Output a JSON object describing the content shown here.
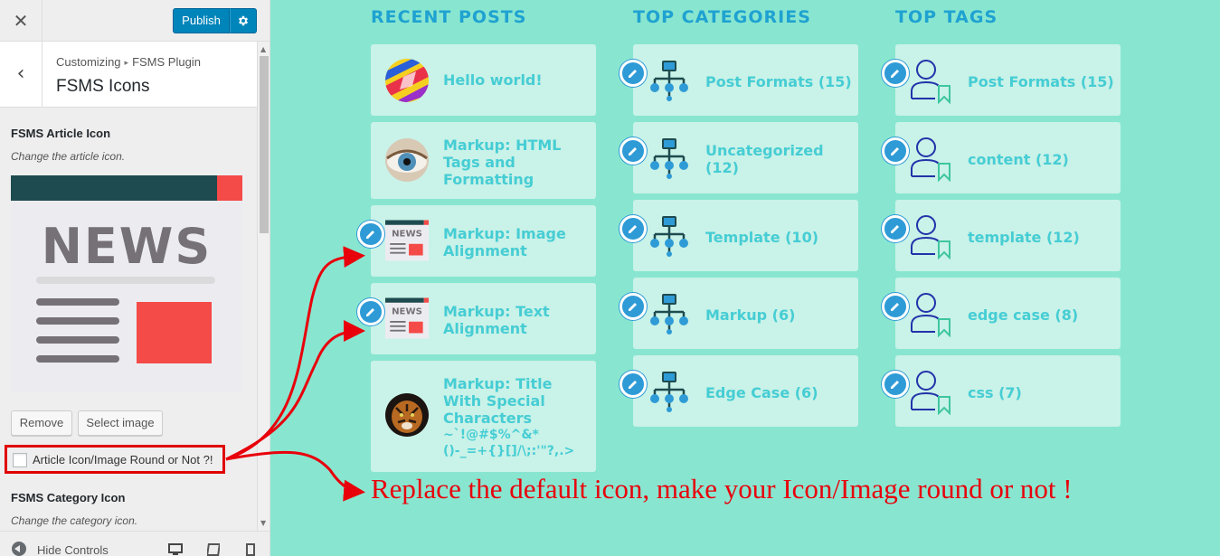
{
  "customizer": {
    "close_label": "✕",
    "publish_label": "Publish",
    "breadcrumb": {
      "parent": "Customizing",
      "separator": "▸",
      "child": "FSMS Plugin"
    },
    "section_title": "FSMS Icons",
    "article_icon": {
      "title": "FSMS Article Icon",
      "description": "Change the article icon.",
      "news_word": "NEWS"
    },
    "remove_label": "Remove",
    "select_image_label": "Select image",
    "round_checkbox_label": "Article Icon/Image Round or Not ?!",
    "round_checked": false,
    "category_icon": {
      "title": "FSMS Category Icon",
      "description": "Change the category icon."
    },
    "footer": {
      "hide_controls": "Hide Controls"
    }
  },
  "preview": {
    "columns": [
      {
        "title": "RECENT POSTS",
        "items": [
          {
            "text": [
              "Hello world!"
            ],
            "thumb": "colorful-art-thumb"
          },
          {
            "text": [
              "Markup: HTML",
              "Tags and",
              "Formatting"
            ],
            "thumb": "eye-thumb"
          },
          {
            "text": [
              "Markup: Image",
              "Alignment"
            ],
            "thumb": "news-icon"
          },
          {
            "text": [
              "Markup: Text",
              "Alignment"
            ],
            "thumb": "news-icon"
          },
          {
            "text": [
              "Markup: Title",
              "With Special",
              "Characters"
            ],
            "extra": [
              "~`!@#$%^&*",
              "()-_=+{}[]/\\;:'\"?,.>"
            ],
            "thumb": "tiger-thumb"
          }
        ]
      },
      {
        "title": "TOP CATEGORIES",
        "items": [
          {
            "text": [
              "Post Formats (15)"
            ]
          },
          {
            "text": [
              "Uncategorized",
              "(12)"
            ]
          },
          {
            "text": [
              "Template (10)"
            ]
          },
          {
            "text": [
              "Markup (6)"
            ]
          },
          {
            "text": [
              "Edge Case (6)"
            ]
          }
        ]
      },
      {
        "title": "TOP TAGS",
        "items": [
          {
            "text": [
              "Post Formats (15)"
            ]
          },
          {
            "text": [
              "content (12)"
            ]
          },
          {
            "text": [
              "template (12)"
            ]
          },
          {
            "text": [
              "edge case (8)"
            ]
          },
          {
            "text": [
              "css (7)"
            ]
          }
        ]
      }
    ],
    "annotation": "Replace the default icon, make your Icon/Image round or not !"
  },
  "colors": {
    "preview_bg": "#88e6d0",
    "card_bg": "#c9f2e8",
    "column_title": "#1fa2d1",
    "item_text": "#46cdd4",
    "pencil_badge": "#2e9bd6",
    "annotation": "#e8000b",
    "publish_button": "#0085ba"
  },
  "icons": [
    "close-icon",
    "gear-icon",
    "back-chevron-icon",
    "news-icon",
    "pencil-icon",
    "sitemap-icon",
    "user-tag-icon",
    "desktop-icon",
    "tablet-icon",
    "mobile-icon",
    "hide-controls-icon"
  ]
}
